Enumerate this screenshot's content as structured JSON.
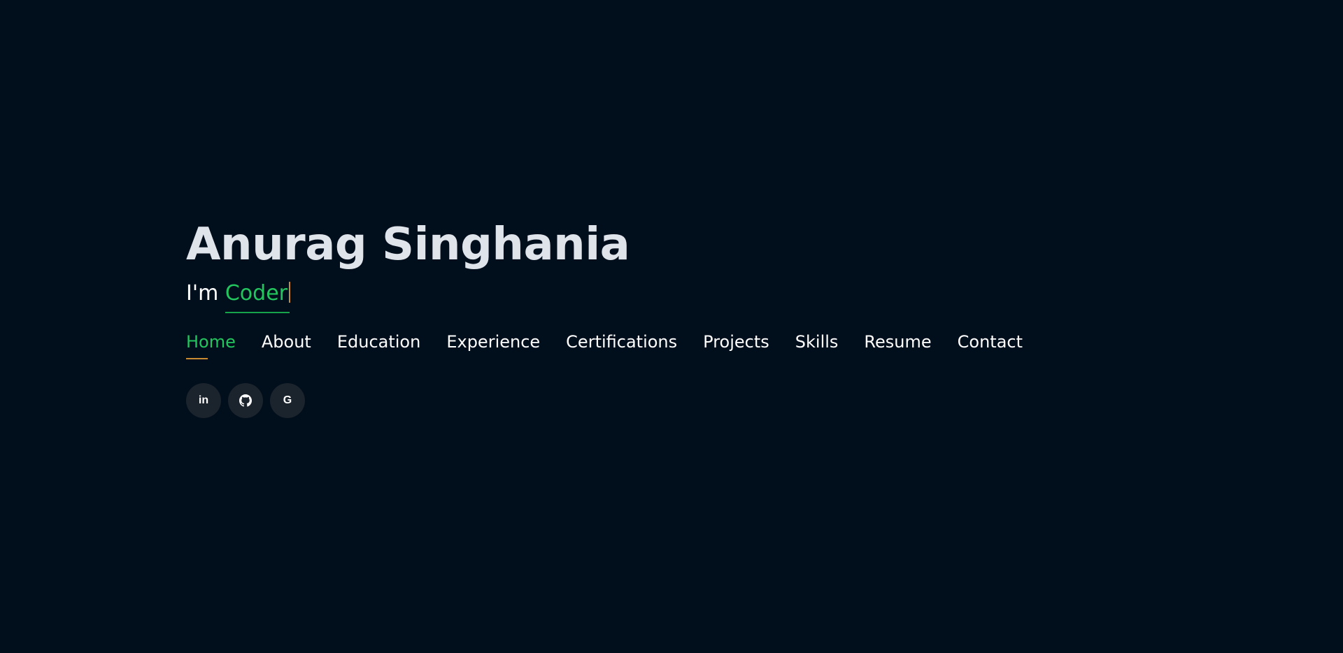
{
  "hero": {
    "name": "Anurag Singhania",
    "tagline_prefix": "I'm ",
    "tagline_role": "Coder"
  },
  "nav": {
    "items": [
      {
        "label": "Home",
        "active": true
      },
      {
        "label": "About"
      },
      {
        "label": "Education"
      },
      {
        "label": "Experience"
      },
      {
        "label": "Certifications"
      },
      {
        "label": "Projects"
      },
      {
        "label": "Skills"
      },
      {
        "label": "Resume"
      },
      {
        "label": "Contact"
      }
    ]
  },
  "socials": {
    "icons": [
      "linkedin-icon",
      "github-icon",
      "google-icon"
    ],
    "linkedin_glyph": "in",
    "google_glyph": "G"
  },
  "colors": {
    "background": "#010e1c",
    "accent": "#22c55e",
    "underline_highlight": "#c98b32",
    "name_text": "#dfe3ea",
    "social_button_bg": "#1b232d"
  }
}
